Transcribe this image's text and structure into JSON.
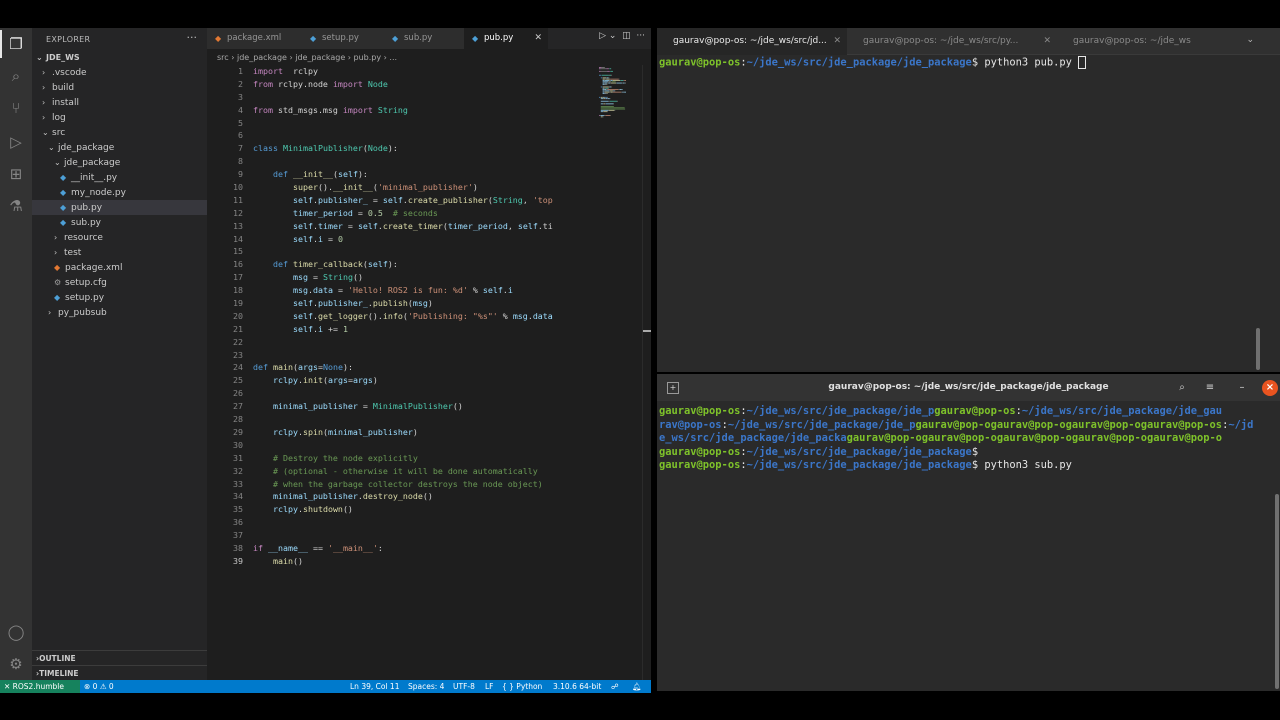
{
  "vscode": {
    "explorer": {
      "header": "EXPLORER",
      "workspace": "JDE_WS",
      "tree": [
        {
          "label": ".vscode",
          "depth": 1,
          "type": "folder",
          "open": false
        },
        {
          "label": "build",
          "depth": 1,
          "type": "folder",
          "open": false
        },
        {
          "label": "install",
          "depth": 1,
          "type": "folder",
          "open": false
        },
        {
          "label": "log",
          "depth": 1,
          "type": "folder",
          "open": false
        },
        {
          "label": "src",
          "depth": 1,
          "type": "folder",
          "open": true
        },
        {
          "label": "jde_package",
          "depth": 2,
          "type": "folder",
          "open": true
        },
        {
          "label": "jde_package",
          "depth": 3,
          "type": "folder",
          "open": true
        },
        {
          "label": "__init__.py",
          "depth": 4,
          "type": "py"
        },
        {
          "label": "my_node.py",
          "depth": 4,
          "type": "py"
        },
        {
          "label": "pub.py",
          "depth": 4,
          "type": "py",
          "selected": true
        },
        {
          "label": "sub.py",
          "depth": 4,
          "type": "py"
        },
        {
          "label": "resource",
          "depth": 3,
          "type": "folder",
          "open": false
        },
        {
          "label": "test",
          "depth": 3,
          "type": "folder",
          "open": false
        },
        {
          "label": "package.xml",
          "depth": 3,
          "type": "xml"
        },
        {
          "label": "setup.cfg",
          "depth": 3,
          "type": "cfg"
        },
        {
          "label": "setup.py",
          "depth": 3,
          "type": "py"
        },
        {
          "label": "py_pubsub",
          "depth": 2,
          "type": "folder",
          "open": false
        }
      ],
      "outline": "OUTLINE",
      "timeline": "TIMELINE"
    },
    "tabs": [
      {
        "label": "package.xml",
        "icon": "xml-file-icon"
      },
      {
        "label": "setup.py",
        "icon": "python-file-icon"
      },
      {
        "label": "sub.py",
        "icon": "python-file-icon"
      },
      {
        "label": "pub.py",
        "icon": "python-file-icon",
        "active": true
      }
    ],
    "breadcrumb": "src  ›  jde_package  ›  jde_package  ›  pub.py  ›  ...",
    "line_numbers": [
      "1",
      "2",
      "3",
      "4",
      "5",
      "6",
      "7",
      "8",
      "9",
      "10",
      "11",
      "12",
      "13",
      "14",
      "15",
      "16",
      "17",
      "18",
      "19",
      "20",
      "21",
      "22",
      "23",
      "24",
      "25",
      "26",
      "27",
      "28",
      "29",
      "30",
      "31",
      "32",
      "33",
      "34",
      "35",
      "36",
      "37",
      "38",
      "39"
    ],
    "current_line": 39,
    "code_lines": [
      [
        [
          "kw",
          "import"
        ],
        [
          "",
          "  rclpy"
        ]
      ],
      [
        [
          "kw",
          "from"
        ],
        [
          "",
          " rclpy.node "
        ],
        [
          "kw",
          "import"
        ],
        [
          "",
          " "
        ],
        [
          "cls",
          "Node"
        ]
      ],
      [],
      [
        [
          "kw",
          "from"
        ],
        [
          "",
          " std_msgs.msg "
        ],
        [
          "kw",
          "import"
        ],
        [
          "",
          " "
        ],
        [
          "cls",
          "String"
        ]
      ],
      [],
      [],
      [
        [
          "kd",
          "class"
        ],
        [
          "",
          " "
        ],
        [
          "cls",
          "MinimalPublisher"
        ],
        [
          "",
          "("
        ],
        [
          "cls",
          "Node"
        ],
        [
          "",
          "):"
        ]
      ],
      [],
      [
        [
          "",
          "    "
        ],
        [
          "kd",
          "def"
        ],
        [
          "",
          " "
        ],
        [
          "fn",
          "__init__"
        ],
        [
          "",
          "("
        ],
        [
          "var",
          "self"
        ],
        [
          "",
          "):"
        ]
      ],
      [
        [
          "",
          "        "
        ],
        [
          "fn",
          "super"
        ],
        [
          "",
          "()."
        ],
        [
          "fn",
          "__init__"
        ],
        [
          "",
          "("
        ],
        [
          "str",
          "'minimal_publisher'"
        ],
        [
          "",
          ")"
        ]
      ],
      [
        [
          "",
          "        "
        ],
        [
          "var",
          "self"
        ],
        [
          "",
          "."
        ],
        [
          "var",
          "publisher_"
        ],
        [
          "",
          " = "
        ],
        [
          "var",
          "self"
        ],
        [
          "",
          "."
        ],
        [
          "fn",
          "create_publisher"
        ],
        [
          "",
          "("
        ],
        [
          "cls",
          "String"
        ],
        [
          "",
          ", "
        ],
        [
          "str",
          "'top"
        ]
      ],
      [
        [
          "",
          "        "
        ],
        [
          "var",
          "timer_period"
        ],
        [
          "",
          " = "
        ],
        [
          "num",
          "0.5"
        ],
        [
          "",
          "  "
        ],
        [
          "cmt",
          "# seconds"
        ]
      ],
      [
        [
          "",
          "        "
        ],
        [
          "var",
          "self"
        ],
        [
          "",
          "."
        ],
        [
          "var",
          "timer"
        ],
        [
          "",
          " = "
        ],
        [
          "var",
          "self"
        ],
        [
          "",
          "."
        ],
        [
          "fn",
          "create_timer"
        ],
        [
          "",
          "("
        ],
        [
          "var",
          "timer_period"
        ],
        [
          "",
          ", "
        ],
        [
          "var",
          "self"
        ],
        [
          "",
          ".ti"
        ]
      ],
      [
        [
          "",
          "        "
        ],
        [
          "var",
          "self"
        ],
        [
          "",
          "."
        ],
        [
          "var",
          "i"
        ],
        [
          "",
          " = "
        ],
        [
          "num",
          "0"
        ]
      ],
      [],
      [
        [
          "",
          "    "
        ],
        [
          "kd",
          "def"
        ],
        [
          "",
          " "
        ],
        [
          "fn",
          "timer_callback"
        ],
        [
          "",
          "("
        ],
        [
          "var",
          "self"
        ],
        [
          "",
          "):"
        ]
      ],
      [
        [
          "",
          "        "
        ],
        [
          "var",
          "msg"
        ],
        [
          "",
          " = "
        ],
        [
          "cls",
          "String"
        ],
        [
          "",
          "()"
        ]
      ],
      [
        [
          "",
          "        "
        ],
        [
          "var",
          "msg"
        ],
        [
          "",
          "."
        ],
        [
          "var",
          "data"
        ],
        [
          "",
          " = "
        ],
        [
          "str",
          "'Hello! ROS2 is fun: %d'"
        ],
        [
          "",
          " % "
        ],
        [
          "var",
          "self"
        ],
        [
          "",
          "."
        ],
        [
          "var",
          "i"
        ]
      ],
      [
        [
          "",
          "        "
        ],
        [
          "var",
          "self"
        ],
        [
          "",
          "."
        ],
        [
          "var",
          "publisher_"
        ],
        [
          "",
          "."
        ],
        [
          "fn",
          "publish"
        ],
        [
          "",
          "("
        ],
        [
          "var",
          "msg"
        ],
        [
          "",
          ")"
        ]
      ],
      [
        [
          "",
          "        "
        ],
        [
          "var",
          "self"
        ],
        [
          "",
          "."
        ],
        [
          "fn",
          "get_logger"
        ],
        [
          "",
          "()."
        ],
        [
          "fn",
          "info"
        ],
        [
          "",
          "("
        ],
        [
          "str",
          "'Publishing: \"%s\"'"
        ],
        [
          "",
          " % "
        ],
        [
          "var",
          "msg"
        ],
        [
          "",
          "."
        ],
        [
          "var",
          "data"
        ]
      ],
      [
        [
          "",
          "        "
        ],
        [
          "var",
          "self"
        ],
        [
          "",
          "."
        ],
        [
          "var",
          "i"
        ],
        [
          "",
          " += "
        ],
        [
          "num",
          "1"
        ]
      ],
      [],
      [],
      [
        [
          "kd",
          "def"
        ],
        [
          "",
          " "
        ],
        [
          "fn",
          "main"
        ],
        [
          "",
          "("
        ],
        [
          "var",
          "args"
        ],
        [
          "",
          "="
        ],
        [
          "kd",
          "None"
        ],
        [
          "",
          "):"
        ]
      ],
      [
        [
          "",
          "    "
        ],
        [
          "var",
          "rclpy"
        ],
        [
          "",
          "."
        ],
        [
          "fn",
          "init"
        ],
        [
          "",
          "("
        ],
        [
          "var",
          "args"
        ],
        [
          "",
          "="
        ],
        [
          "var",
          "args"
        ],
        [
          "",
          ")"
        ]
      ],
      [],
      [
        [
          "",
          "    "
        ],
        [
          "var",
          "minimal_publisher"
        ],
        [
          "",
          " = "
        ],
        [
          "cls",
          "MinimalPublisher"
        ],
        [
          "",
          "()"
        ]
      ],
      [],
      [
        [
          "",
          "    "
        ],
        [
          "var",
          "rclpy"
        ],
        [
          "",
          "."
        ],
        [
          "fn",
          "spin"
        ],
        [
          "",
          "("
        ],
        [
          "var",
          "minimal_publisher"
        ],
        [
          "",
          ")"
        ]
      ],
      [],
      [
        [
          "",
          "    "
        ],
        [
          "cmt",
          "# Destroy the node explicitly"
        ]
      ],
      [
        [
          "",
          "    "
        ],
        [
          "cmt",
          "# (optional - otherwise it will be done automatically"
        ]
      ],
      [
        [
          "",
          "    "
        ],
        [
          "cmt",
          "# when the garbage collector destroys the node object)"
        ]
      ],
      [
        [
          "",
          "    "
        ],
        [
          "var",
          "minimal_publisher"
        ],
        [
          "",
          "."
        ],
        [
          "fn",
          "destroy_node"
        ],
        [
          "",
          "()"
        ]
      ],
      [
        [
          "",
          "    "
        ],
        [
          "var",
          "rclpy"
        ],
        [
          "",
          "."
        ],
        [
          "fn",
          "shutdown"
        ],
        [
          "",
          "()"
        ]
      ],
      [],
      [],
      [
        [
          "kw",
          "if"
        ],
        [
          "",
          " "
        ],
        [
          "var",
          "__name__"
        ],
        [
          "",
          " == "
        ],
        [
          "str",
          "'__main__'"
        ],
        [
          "",
          ":"
        ]
      ],
      [
        [
          "",
          "    "
        ],
        [
          "fn",
          "main"
        ],
        [
          "",
          "()"
        ]
      ]
    ],
    "statusbar": {
      "remote": "ROS2.humble",
      "problems": "⊗ 0 ⚠ 0",
      "position": "Ln 39, Col 11",
      "spaces": "Spaces: 4",
      "encoding": "UTF-8",
      "eol": "LF",
      "language": "{ } Python",
      "interpreter": "3.10.6 64-bit"
    }
  },
  "terminal1": {
    "tabs": [
      {
        "label": "gaurav@pop-os: ~/jde_ws/src/jd...",
        "active": true
      },
      {
        "label": "gaurav@pop-os: ~/jde_ws/src/py...",
        "active": false
      },
      {
        "label": "gaurav@pop-os: ~/jde_ws",
        "active": false
      }
    ],
    "prompt_user": "gaurav@pop-os",
    "prompt_path": "~/jde_ws/src/jde_package/jde_package",
    "command": "python3 pub.py"
  },
  "terminal2": {
    "title": "gaurav@pop-os: ~/jde_ws/src/jde_package/jde_package",
    "lines": [
      [
        [
          "pu",
          "gaurav@pop-os"
        ],
        [
          "",
          ":"
        ],
        [
          "pp",
          "~/jde_ws/src/jde_package/jde_p"
        ],
        [
          "pu",
          "gaurav@pop-os"
        ],
        [
          "",
          ":"
        ],
        [
          "pp",
          "~/jde_ws/src/jde_package/jde_gau"
        ]
      ],
      [
        [
          "pp",
          "rav@pop-os"
        ],
        [
          "",
          ":"
        ],
        [
          "pp",
          "~/jde_ws/src/jde_package/jde_p"
        ],
        [
          "pu",
          "gaurav@pop-o"
        ],
        [
          "pu",
          "gaurav@pop-o"
        ],
        [
          "pu",
          "gaurav@pop-o"
        ],
        [
          "pu",
          "gaurav@pop-os"
        ],
        [
          "",
          ":"
        ],
        [
          "pp",
          "~/jd"
        ]
      ],
      [
        [
          "pp",
          "e_ws/src/jde_package/jde_packa"
        ],
        [
          "pu",
          "gaurav@pop-o"
        ],
        [
          "pu",
          "gaurav@pop-o"
        ],
        [
          "pu",
          "gaurav@pop-o"
        ],
        [
          "pu",
          "gaurav@pop-o"
        ],
        [
          "pu",
          "gaurav@pop-o"
        ]
      ],
      [
        [
          "pu",
          "gaurav@pop-os"
        ],
        [
          "",
          ":"
        ],
        [
          "pp",
          "~/jde_ws/src/jde_package/jde_package"
        ],
        [
          "",
          "$"
        ]
      ],
      [
        [
          "pu",
          "gaurav@pop-os"
        ],
        [
          "",
          ":"
        ],
        [
          "pp",
          "~/jde_ws/src/jde_package/jde_package"
        ],
        [
          "",
          "$ python3 sub.py"
        ]
      ]
    ]
  }
}
